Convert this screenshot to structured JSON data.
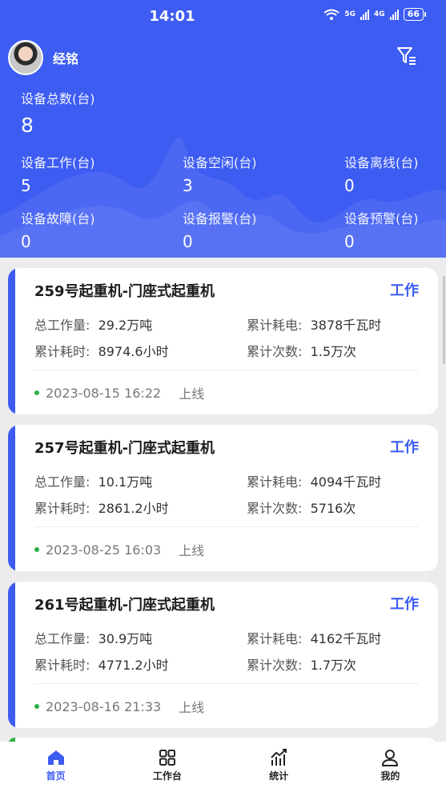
{
  "status_bar": {
    "time": "14:01",
    "net1": "5G",
    "net2": "4G",
    "battery": "66"
  },
  "user": {
    "name": "经铭"
  },
  "summary": {
    "total": {
      "label": "设备总数(台)",
      "value": "8"
    },
    "items": [
      {
        "label": "设备工作(台)",
        "value": "5"
      },
      {
        "label": "设备空闲(台)",
        "value": "3"
      },
      {
        "label": "设备离线(台)",
        "value": "0"
      },
      {
        "label": "设备故障(台)",
        "value": "0"
      },
      {
        "label": "设备报警(台)",
        "value": "0"
      },
      {
        "label": "设备预警(台)",
        "value": "0"
      }
    ]
  },
  "devices": [
    {
      "name": "259号起重机-门座式起重机",
      "status": "工作",
      "work_label": "总工作量:",
      "work": "29.2万吨",
      "power_label": "累计耗电:",
      "power": "3878千瓦时",
      "time_label": "累计耗时:",
      "time": "8974.6小时",
      "count_label": "累计次数:",
      "count": "1.5万次",
      "datetime": "2023-08-15 16:22",
      "event": "上线"
    },
    {
      "name": "257号起重机-门座式起重机",
      "status": "工作",
      "work_label": "总工作量:",
      "work": "10.1万吨",
      "power_label": "累计耗电:",
      "power": "4094千瓦时",
      "time_label": "累计耗时:",
      "time": "2861.2小时",
      "count_label": "累计次数:",
      "count": "5716次",
      "datetime": "2023-08-25 16:03",
      "event": "上线"
    },
    {
      "name": "261号起重机-门座式起重机",
      "status": "工作",
      "work_label": "总工作量:",
      "work": "30.9万吨",
      "power_label": "累计耗电:",
      "power": "4162千瓦时",
      "time_label": "累计耗时:",
      "time": "4771.2小时",
      "count_label": "累计次数:",
      "count": "1.7万次",
      "datetime": "2023-08-16 21:33",
      "event": "上线"
    }
  ],
  "tabs": [
    {
      "label": "首页",
      "icon": "home-icon"
    },
    {
      "label": "工作台",
      "icon": "grid-icon"
    },
    {
      "label": "统计",
      "icon": "chart-icon"
    },
    {
      "label": "我的",
      "icon": "person-icon"
    }
  ],
  "colors": {
    "primary": "#3d5cf2",
    "online_dot": "#2fb14a",
    "background": "#ececee"
  }
}
